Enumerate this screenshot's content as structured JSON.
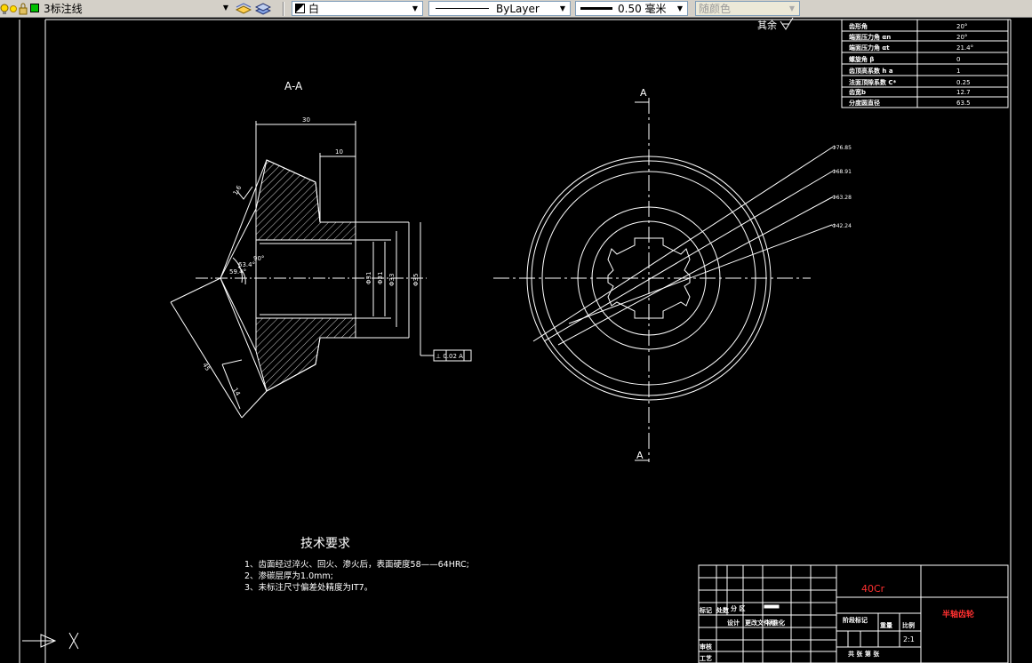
{
  "toolbar": {
    "layer_name": "3标注线",
    "layer_color": "白",
    "linetype": "ByLayer",
    "lineweight": "0.50 毫米",
    "plot_style": "随颜色"
  },
  "colors": {
    "background": "#000000",
    "lines": "#ffffff",
    "material": "#ff3030"
  },
  "section_label": "A-A",
  "section_mark": "A",
  "roughness_label": "其余",
  "dimensions": {
    "width_total": "30",
    "width_hub": "10",
    "diameters": [
      "Φ31",
      "Φ31",
      "Φ33",
      "Φ35"
    ],
    "angles": [
      "1.6",
      "63.4°",
      "59.4°",
      "90°"
    ],
    "cone_length": "45",
    "face_width": "14",
    "tolerance_frame": "⊥ 0.02 A"
  },
  "leader_dims": [
    "Φ76.85",
    "Φ68.91",
    "Φ63.28",
    "Φ42.24"
  ],
  "param_table": [
    [
      "齿形角",
      "20°"
    ],
    [
      "端面压力角  αn",
      "20°"
    ],
    [
      "端面压力角  αt",
      "21.4°"
    ],
    [
      "螺旋角  β",
      "0"
    ],
    [
      "齿顶高系数  h a",
      "1"
    ],
    [
      "法面顶隙系数  C*",
      "0.25"
    ],
    [
      "齿宽b",
      "12.7"
    ],
    [
      "分度圆直径",
      "63.5"
    ]
  ],
  "tech_requirements": {
    "title": "技术要求",
    "items": [
      "1、齿面经过淬火、回火、渗火后，表面硬度58——64HRC;",
      "2、渗碳层厚为1.0mm;",
      "3、未标注尺寸偏差处精度为IT7。"
    ]
  },
  "title_block": {
    "material": "40Cr",
    "part_name": "半轴齿轮",
    "scale": "2:1",
    "labels": {
      "mark": "标记",
      "count": "处数",
      "zone": "分  区",
      "design": "设计",
      "std": "标准化",
      "doc_no": "更改文件号",
      "sign": "签名",
      "stage": "阶段标记",
      "weight": "重量",
      "scale_lbl": "比例",
      "review": "审核",
      "craft": "工艺",
      "sheets": "共  张  第  张"
    }
  }
}
